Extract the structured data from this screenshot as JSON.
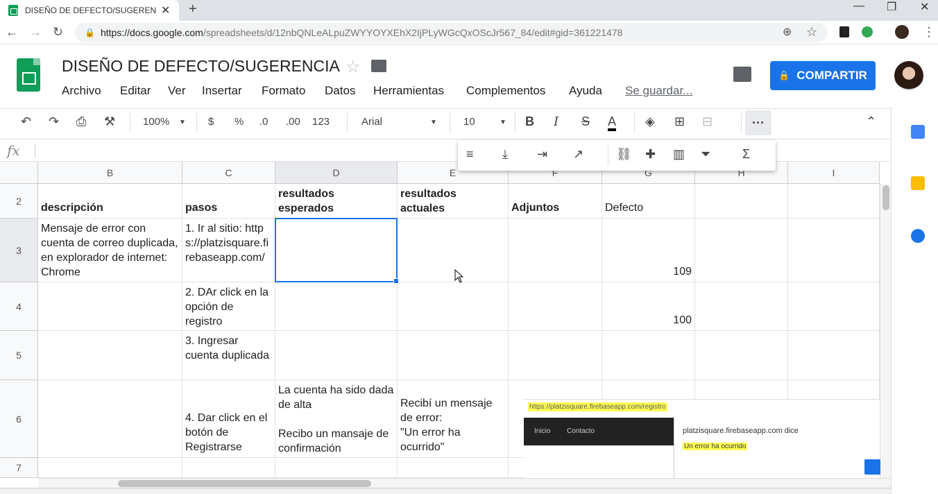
{
  "browser": {
    "tab_title": "DISEÑO DE DEFECTO/SUGERENC",
    "url_host": "https://docs.google.com",
    "url_path": "/spreadsheets/d/12nbQNLeALpuZWYYOYXEhX2IjPLyWGcQxOScJr567_84/edit#gid=361221478"
  },
  "doc": {
    "title": "DISEÑO DE DEFECTO/SUGERENCIA",
    "menus": [
      "Archivo",
      "Editar",
      "Ver",
      "Insertar",
      "Formato",
      "Datos",
      "Herramientas",
      "Complementos",
      "Ayuda"
    ],
    "saving": "Se guardar...",
    "share_label": "COMPARTIR"
  },
  "toolbar": {
    "zoom": "100%",
    "currency": "$",
    "percent": "%",
    "dec_less": ".0",
    "dec_more": ".00",
    "format": "123",
    "font": "Arial",
    "size": "10",
    "bold": "B",
    "italic": "I",
    "strike": "S",
    "text_color": "A",
    "more": "···"
  },
  "formula": {
    "fx": "fx"
  },
  "columns": [
    "B",
    "C",
    "D",
    "E",
    "F",
    "G",
    "H",
    "I"
  ],
  "rows": [
    {
      "num": "2",
      "cells": [
        "descripción",
        "pasos",
        "resultados\nesperados",
        "resultados\nactuales",
        "Adjuntos",
        "Defecto",
        "",
        ""
      ]
    },
    {
      "num": "3",
      "cells": [
        "Mensaje de error con cuenta de correo duplicada, en explorador de internet: Chrome",
        "1. Ir al sitio: https://platzisquare.firebaseapp.com/",
        "",
        "",
        "",
        "109",
        "",
        ""
      ]
    },
    {
      "num": "4",
      "cells": [
        "",
        "2. DAr click en la opción de registro",
        "",
        "",
        "",
        "100",
        "",
        ""
      ]
    },
    {
      "num": "5",
      "cells": [
        "",
        "3. Ingresar cuenta duplicada",
        "",
        "",
        "",
        "",
        "",
        ""
      ]
    },
    {
      "num": "6",
      "cells": [
        "",
        "4. Dar click en el botón de Registrarse",
        "La cuenta ha sido dada de alta\n\nRecibo un mansaje de confirmación",
        "Recibí un mensaje de error:\n\"Un error ha ocurrido\"",
        "",
        "",
        "",
        ""
      ]
    },
    {
      "num": "7",
      "cells": [
        "",
        "",
        "",
        "",
        "",
        "",
        "",
        ""
      ]
    }
  ],
  "overlay": {
    "url": "https://platzisquare.firebaseapp.com/registro",
    "nav": [
      "Inicio",
      "Contacto"
    ],
    "dialog_title": "platzisquare.firebaseapp.com dice",
    "dialog_msg": "Un error ha ocurrido"
  },
  "colors": {
    "accent": "#1a73e8",
    "sheets_green": "#0f9d58",
    "highlight": "#ffff55"
  }
}
